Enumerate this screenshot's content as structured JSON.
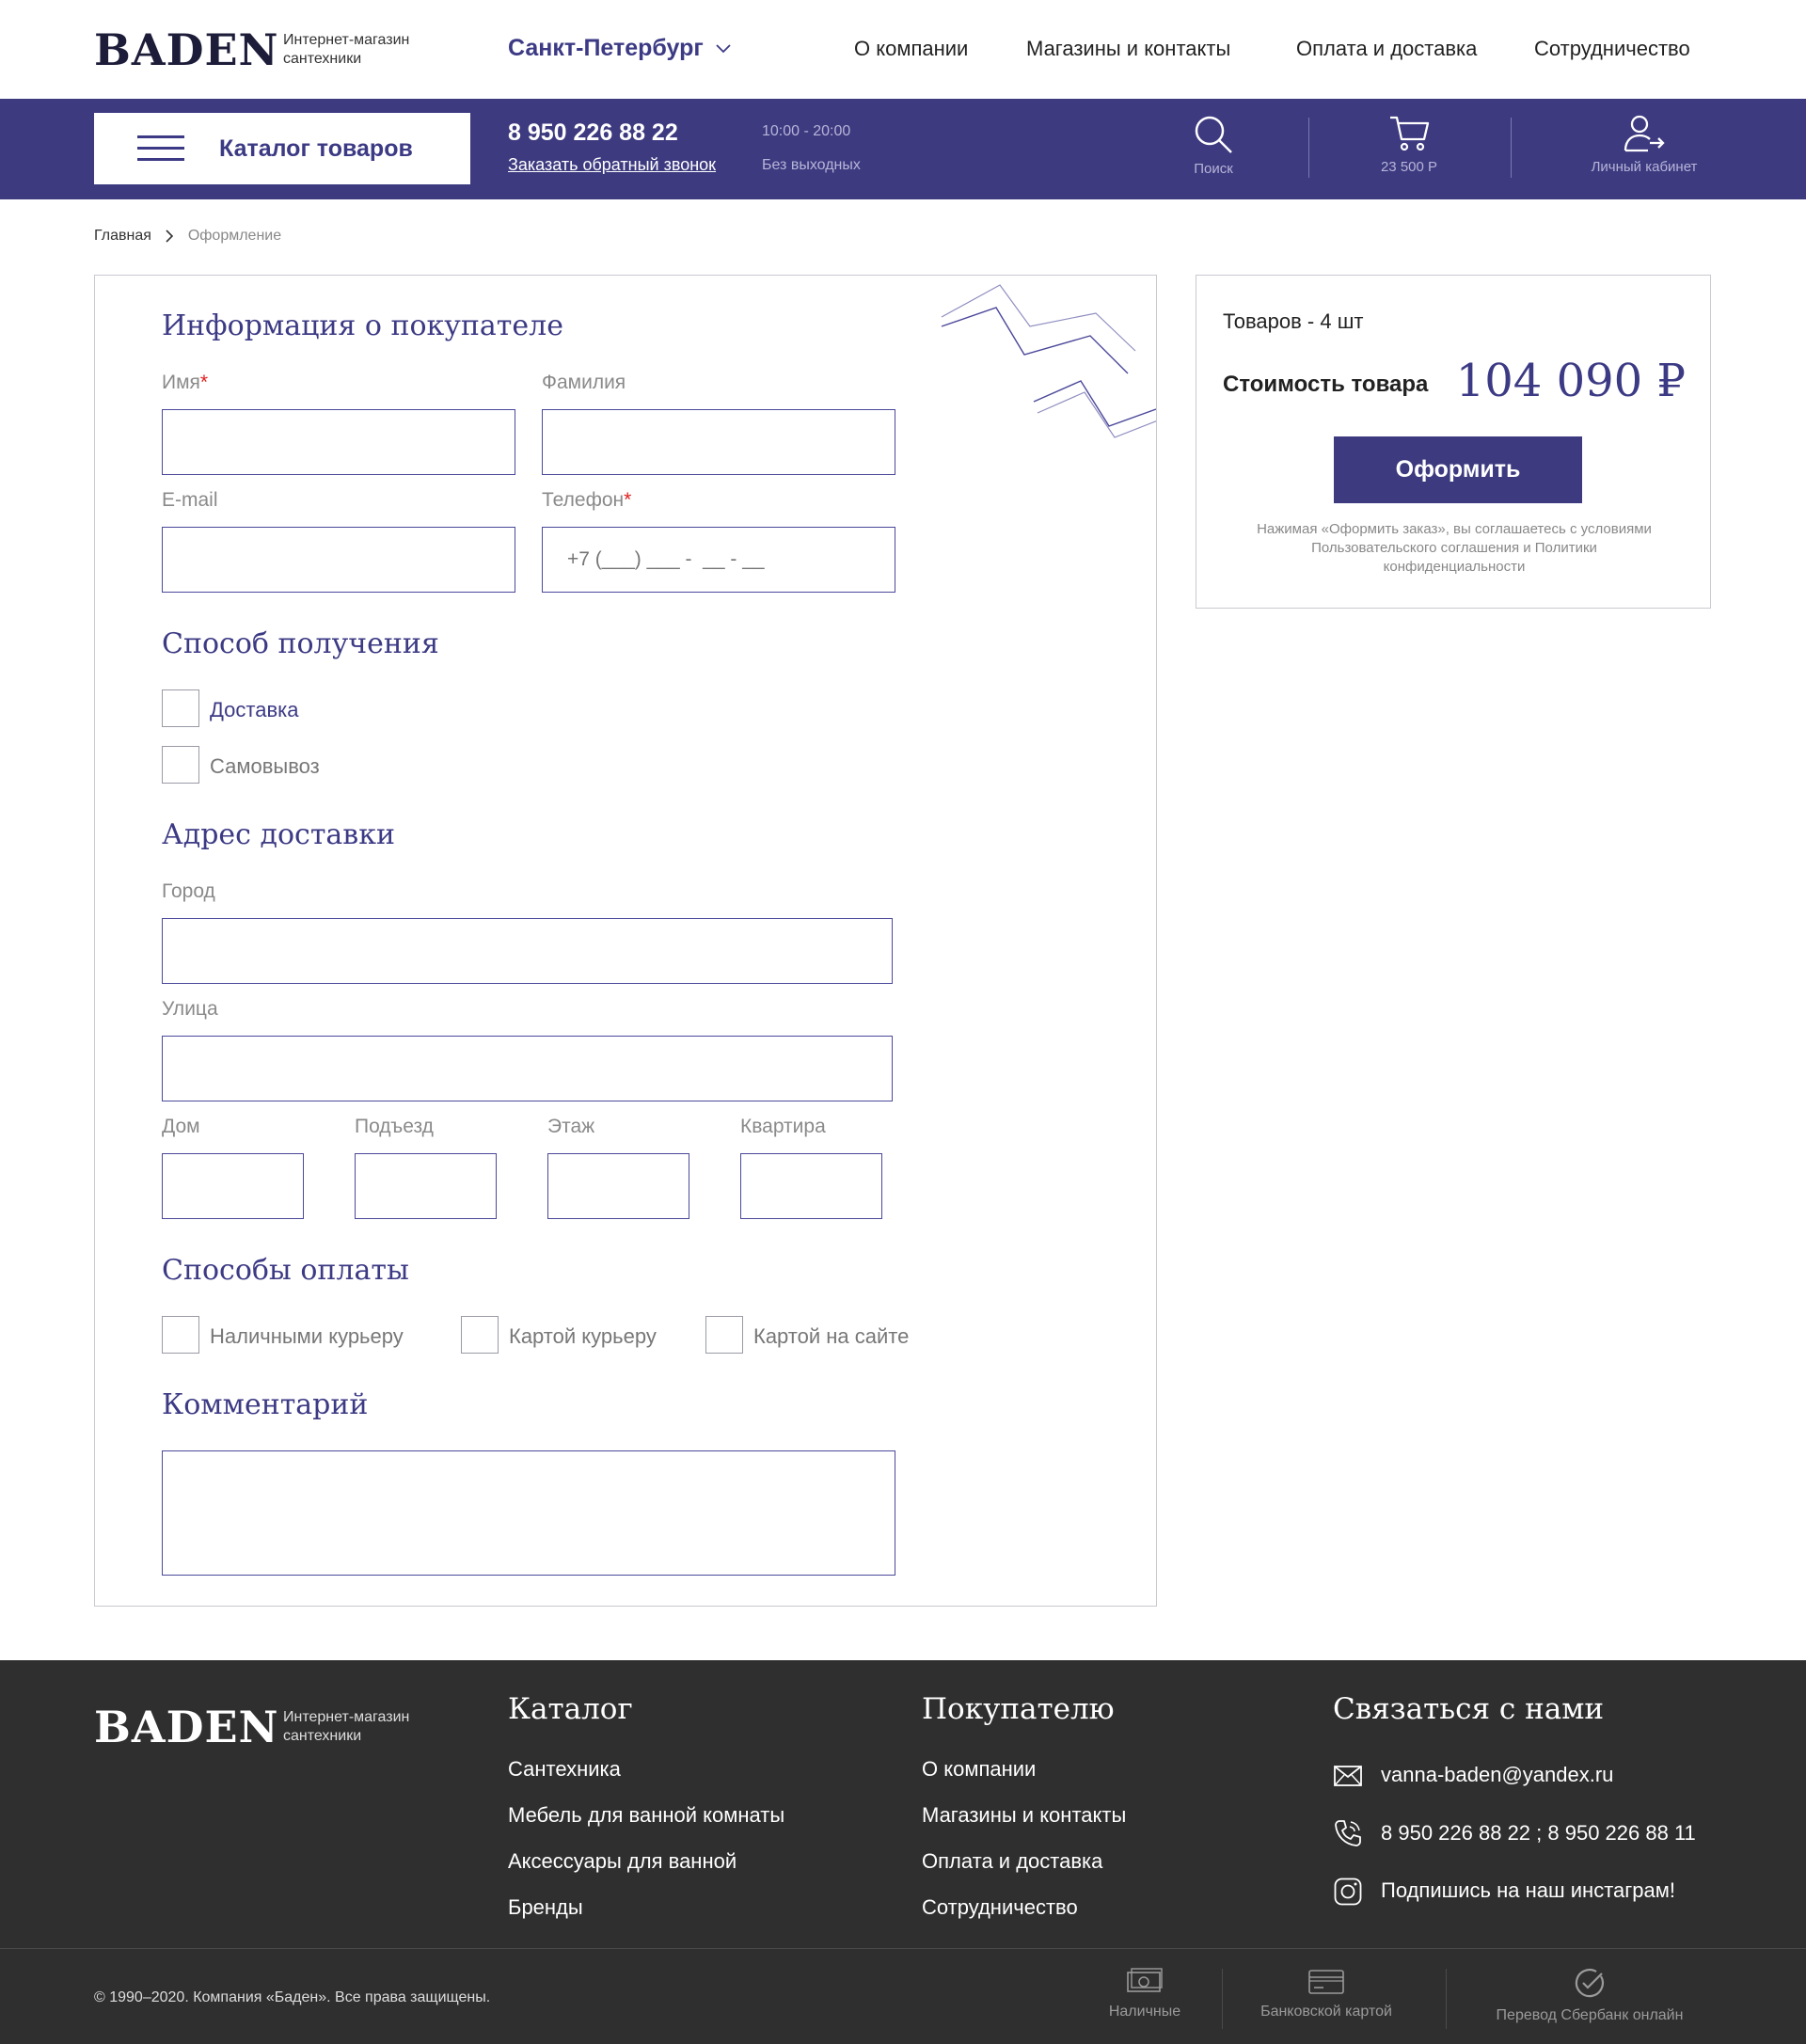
{
  "header": {
    "logo": "BADEN",
    "logo_sub_line1": "Интернет-магазин",
    "logo_sub_line2": "сантехники",
    "city": "Санкт-Петербург",
    "nav": [
      "О компании",
      "Магазины и контакты",
      "Оплата и доставка",
      "Сотрудничество"
    ]
  },
  "bar": {
    "catalog_label": "Каталог товаров",
    "phone": "8 950 226 88 22",
    "callback": "Заказать обратный звонок",
    "hours": "10:00 - 20:00",
    "days": "Без выходных",
    "search_label": "Поиск",
    "cart_label": "23 500 Р",
    "account_label": "Личный кабинет"
  },
  "breadcrumb": {
    "home": "Главная",
    "current": "Оформление"
  },
  "form": {
    "buyer_title": "Информация о покупателе",
    "first_name_label": "Имя",
    "last_name_label": "Фамилия",
    "email_label": "E-mail",
    "phone_label": "Телефон",
    "phone_placeholder": "+7 (___) ___ -  __ - __",
    "required_mark": "*",
    "receive_title": "Способ получения",
    "receive_options": [
      "Доставка",
      "Самовывоз"
    ],
    "address_title": "Адрес доставки",
    "city_label": "Город",
    "street_label": "Улица",
    "house_label": "Дом",
    "entrance_label": "Подъезд",
    "floor_label": "Этаж",
    "apartment_label": "Квартира",
    "payment_title": "Способы оплаты",
    "payment_options": [
      "Наличными курьеру",
      "Картой курьеру",
      "Картой на сайте"
    ],
    "comment_title": "Комментарий"
  },
  "summary": {
    "items_count": "Товаров - 4 шт",
    "cost_label": "Стоимость товара",
    "price": "104 090 ₽",
    "order_button": "Оформить",
    "note": "Нажимая «Оформить заказ», вы соглашаетесь с условиями Пользовательского соглашения и Политики конфиденциальности"
  },
  "footer": {
    "logo": "BADEN",
    "logo_sub_line1": "Интернет-магазин",
    "logo_sub_line2": "сантехники",
    "catalog_title": "Каталог",
    "catalog_links": [
      "Сантехника",
      "Мебель для ванной комнаты",
      "Аксессуары для ванной",
      "Бренды"
    ],
    "buyer_title": "Покупателю",
    "buyer_links": [
      "О компании",
      "Магазины и контакты",
      "Оплата и доставка",
      "Сотрудничество"
    ],
    "contact_title": "Связаться с нами",
    "email": "vanna-baden@yandex.ru",
    "phones": "8 950 226 88 22 ; 8 950 226 88 11",
    "instagram": "Подпишись на наш инстаграм!",
    "copyright": "© 1990–2020. Компания «Баден». Все права защищены.",
    "pay_cash": "Наличные",
    "pay_card": "Банковской картой",
    "pay_sber": "Перевод Сбербанк онлайн"
  },
  "colors": {
    "brand": "#3d3a80",
    "accent_text": "#3c3a84",
    "footer_bg": "#2f2f2f",
    "required": "#e02020"
  }
}
